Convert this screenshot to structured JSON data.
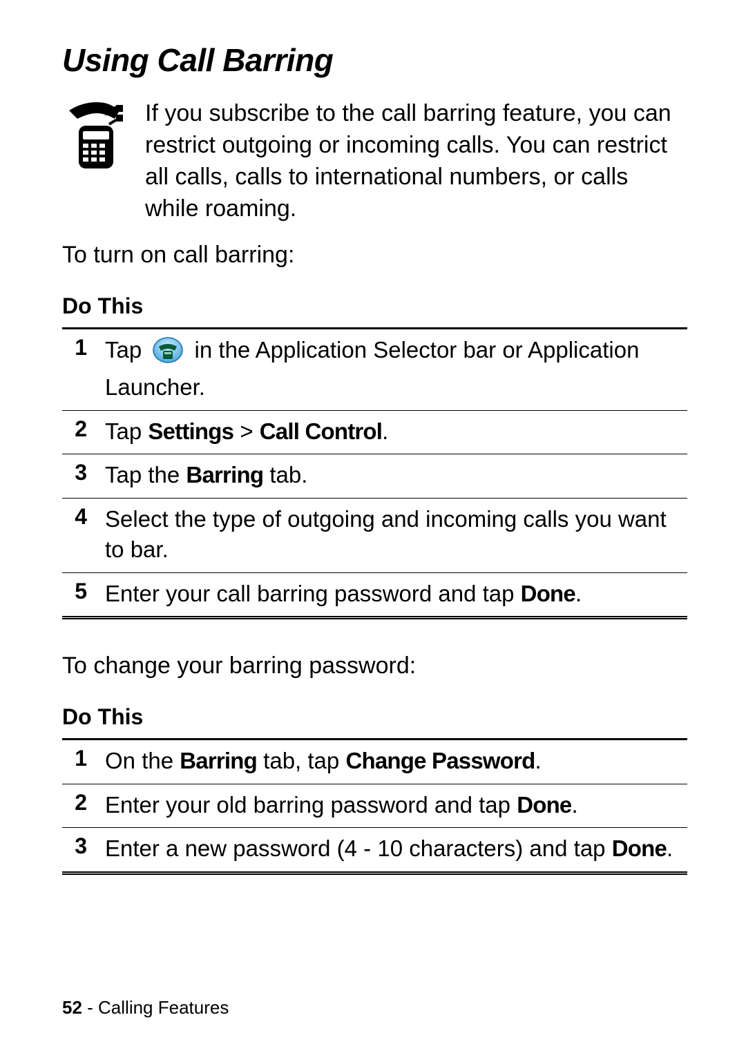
{
  "heading": "Using Call Barring",
  "intro": "If you subscribe to the call barring feature, you can restrict outgoing or incoming calls. You can restrict all calls, calls to international numbers, or calls while roaming.",
  "lead1": "To turn on call barring:",
  "do_this": "Do This",
  "steps1": {
    "n1": "1",
    "s1_a": "Tap ",
    "s1_b": " in the Application Selector bar or Application Launcher.",
    "n2": "2",
    "s2_a": "Tap ",
    "s2_b": "Settings",
    "s2_c": " > ",
    "s2_d": "Call Control",
    "s2_e": ".",
    "n3": "3",
    "s3_a": "Tap the ",
    "s3_b": "Barring",
    "s3_c": " tab.",
    "n4": "4",
    "s4": "Select the type of outgoing and incoming calls you want to bar.",
    "n5": "5",
    "s5_a": "Enter your call barring password and tap ",
    "s5_b": "Done",
    "s5_c": "."
  },
  "lead2": "To change your barring password:",
  "steps2": {
    "n1": "1",
    "s1_a": "On the ",
    "s1_b": "Barring",
    "s1_c": " tab, tap ",
    "s1_d": "Change Password",
    "s1_e": ".",
    "n2": "2",
    "s2_a": "Enter your old barring password and tap ",
    "s2_b": "Done",
    "s2_c": ".",
    "n3": "3",
    "s3_a": "Enter a new password (4 - 10 characters) and tap ",
    "s3_b": "Done",
    "s3_c": "."
  },
  "footer": {
    "page": "52",
    "sep": " - ",
    "section": "Calling Features"
  }
}
